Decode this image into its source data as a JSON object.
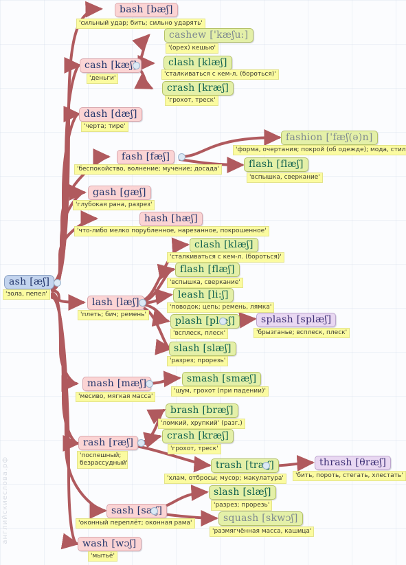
{
  "watermark": "английскиеслова.рф",
  "root": {
    "word": "ash [æʃ]",
    "gloss": "'зола, пепел'"
  },
  "nodes": [
    {
      "id": "bash",
      "word": "bash [bæʃ]",
      "gloss": "'сильный удар; бить; сильно ударять'"
    },
    {
      "id": "cashew",
      "word": "cashew ['kæʃu:]",
      "gloss": "'(орех) кешью'"
    },
    {
      "id": "cash",
      "word": "cash [kæʃ]",
      "gloss": "'деньги'"
    },
    {
      "id": "clash1",
      "word": "clash [klæʃ]",
      "gloss": "'сталкиваться с кем-л. (бороться)'"
    },
    {
      "id": "crash1",
      "word": "crash [kræʃ]",
      "gloss": "'грохот, треск'"
    },
    {
      "id": "dash",
      "word": "dash [dæʃ]",
      "gloss": "'черта; тире'"
    },
    {
      "id": "fashion",
      "word": "fashion ['fæʃ(ə)n]",
      "gloss": "'форма, очертания; покрой (об одежде); мода, стиль'"
    },
    {
      "id": "fash",
      "word": "fash [fæʃ]",
      "gloss": "'беспокойство, волнение; мучение; досада'"
    },
    {
      "id": "flash1",
      "word": "flash [flæʃ]",
      "gloss": "'вспышка, сверкание'"
    },
    {
      "id": "gash",
      "word": "gash [gæʃ]",
      "gloss": "'глубокая рана, разрез'"
    },
    {
      "id": "hash",
      "word": "hash [hæʃ]",
      "gloss": "'что-либо мелко порубленное, нарезанное, покрошенное'"
    },
    {
      "id": "clash2",
      "word": "clash [klæʃ]",
      "gloss": "'сталкиваться с кем-л. (бороться)'"
    },
    {
      "id": "flash2",
      "word": "flash [flæʃ]",
      "gloss": "'вспышка, сверкание'"
    },
    {
      "id": "leash",
      "word": "leash [li:ʃ]",
      "gloss": "'поводок; цепь; ремень, лямка'"
    },
    {
      "id": "lash",
      "word": "lash [læʃ]",
      "gloss": "'плеть; бич; ремень'"
    },
    {
      "id": "plash",
      "word": "plash [plæʃ]",
      "gloss": "'всплеск, плеск'"
    },
    {
      "id": "splash",
      "word": "splash [splæʃ]",
      "gloss": "'брызганье; всплеск, плеск'"
    },
    {
      "id": "slash1",
      "word": "slash [slæʃ]",
      "gloss": "'разрез; прорезь'"
    },
    {
      "id": "mash",
      "word": "mash [mæʃ]",
      "gloss": "'месиво, мягкая масса'"
    },
    {
      "id": "smash",
      "word": "smash [smæʃ]",
      "gloss": "'шум, грохот (при падении)'"
    },
    {
      "id": "brash",
      "word": "brash [bræʃ]",
      "gloss": "'ломкий, хрупкий' (разг.)"
    },
    {
      "id": "rash",
      "word": "rash [ræʃ]",
      "gloss": "'поспешный; безрассудный'"
    },
    {
      "id": "crash2",
      "word": "crash [kræʃ]",
      "gloss": "'грохот, треск'"
    },
    {
      "id": "trash",
      "word": "trash [træʃ]",
      "gloss": "'хлам, отбросы; мусор; макулатура'"
    },
    {
      "id": "thrash",
      "word": "thrash [θræʃ]",
      "gloss": "'бить, пороть, стегать, хлестать'"
    },
    {
      "id": "slash2",
      "word": "slash [slæʃ]",
      "gloss": "'разрез; прорезь'"
    },
    {
      "id": "sash",
      "word": "sash [sæʃ]",
      "gloss": "'оконный переплёт; оконная рама'"
    },
    {
      "id": "squash",
      "word": "squash [skwɔʃ]",
      "gloss": "'размягчённая масса, кашица'"
    },
    {
      "id": "wash",
      "word": "wash [wɔʃ]",
      "gloss": "'мытьё'"
    }
  ],
  "colors": {
    "root_fill": "#c3d4ee",
    "level1_fill": "#fbd4d4",
    "level2_fill": "#e4f0a8",
    "level3_fill": "#e9d8f2",
    "gloss_fill": "#fbfba0",
    "edge": "#b05a5e",
    "background": "#fbfcfe"
  }
}
